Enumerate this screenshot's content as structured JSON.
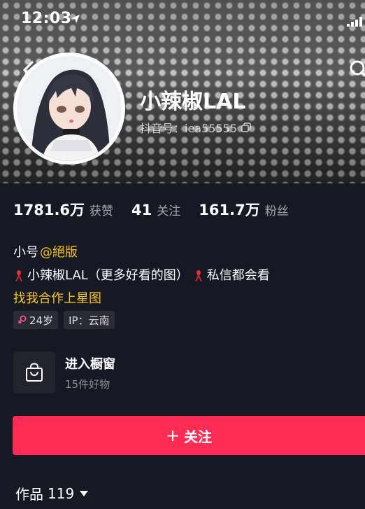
{
  "status_bar": {
    "time": "12:03"
  },
  "profile": {
    "nickname": "小辣椒LAL",
    "douyin_id": "抖音号：iea55555"
  },
  "stats": [
    {
      "value": "1781.6万",
      "label": "获赞"
    },
    {
      "value": "41",
      "label": "关注"
    },
    {
      "value": "161.7万",
      "label": "粉丝"
    }
  ],
  "bio": {
    "line1_prefix": "小号",
    "line1_mention": "@絕版",
    "line2_text": "小辣椒LAL（更多好看的图）",
    "line2_suffix": "私信都会看",
    "line3_link": "找我合作上星图"
  },
  "tags": {
    "age": "24岁",
    "ip": "IP：云南"
  },
  "shop": {
    "title": "进入橱窗",
    "subtitle": "15件好物"
  },
  "follow_button": {
    "plus": "+",
    "label": "关注"
  },
  "works_tab": {
    "label": "作品",
    "count": "119"
  },
  "colors": {
    "accent": "#fe2c55",
    "highlight": "#f5c518",
    "background": "#161823"
  },
  "icons": {
    "back": "chevron-left-icon",
    "search": "search-icon",
    "copy": "copy-icon",
    "shop": "shopping-bag-icon",
    "ribbon": "red-ribbon-icon",
    "gender": "female-icon",
    "dropdown": "triangle-down-icon"
  }
}
